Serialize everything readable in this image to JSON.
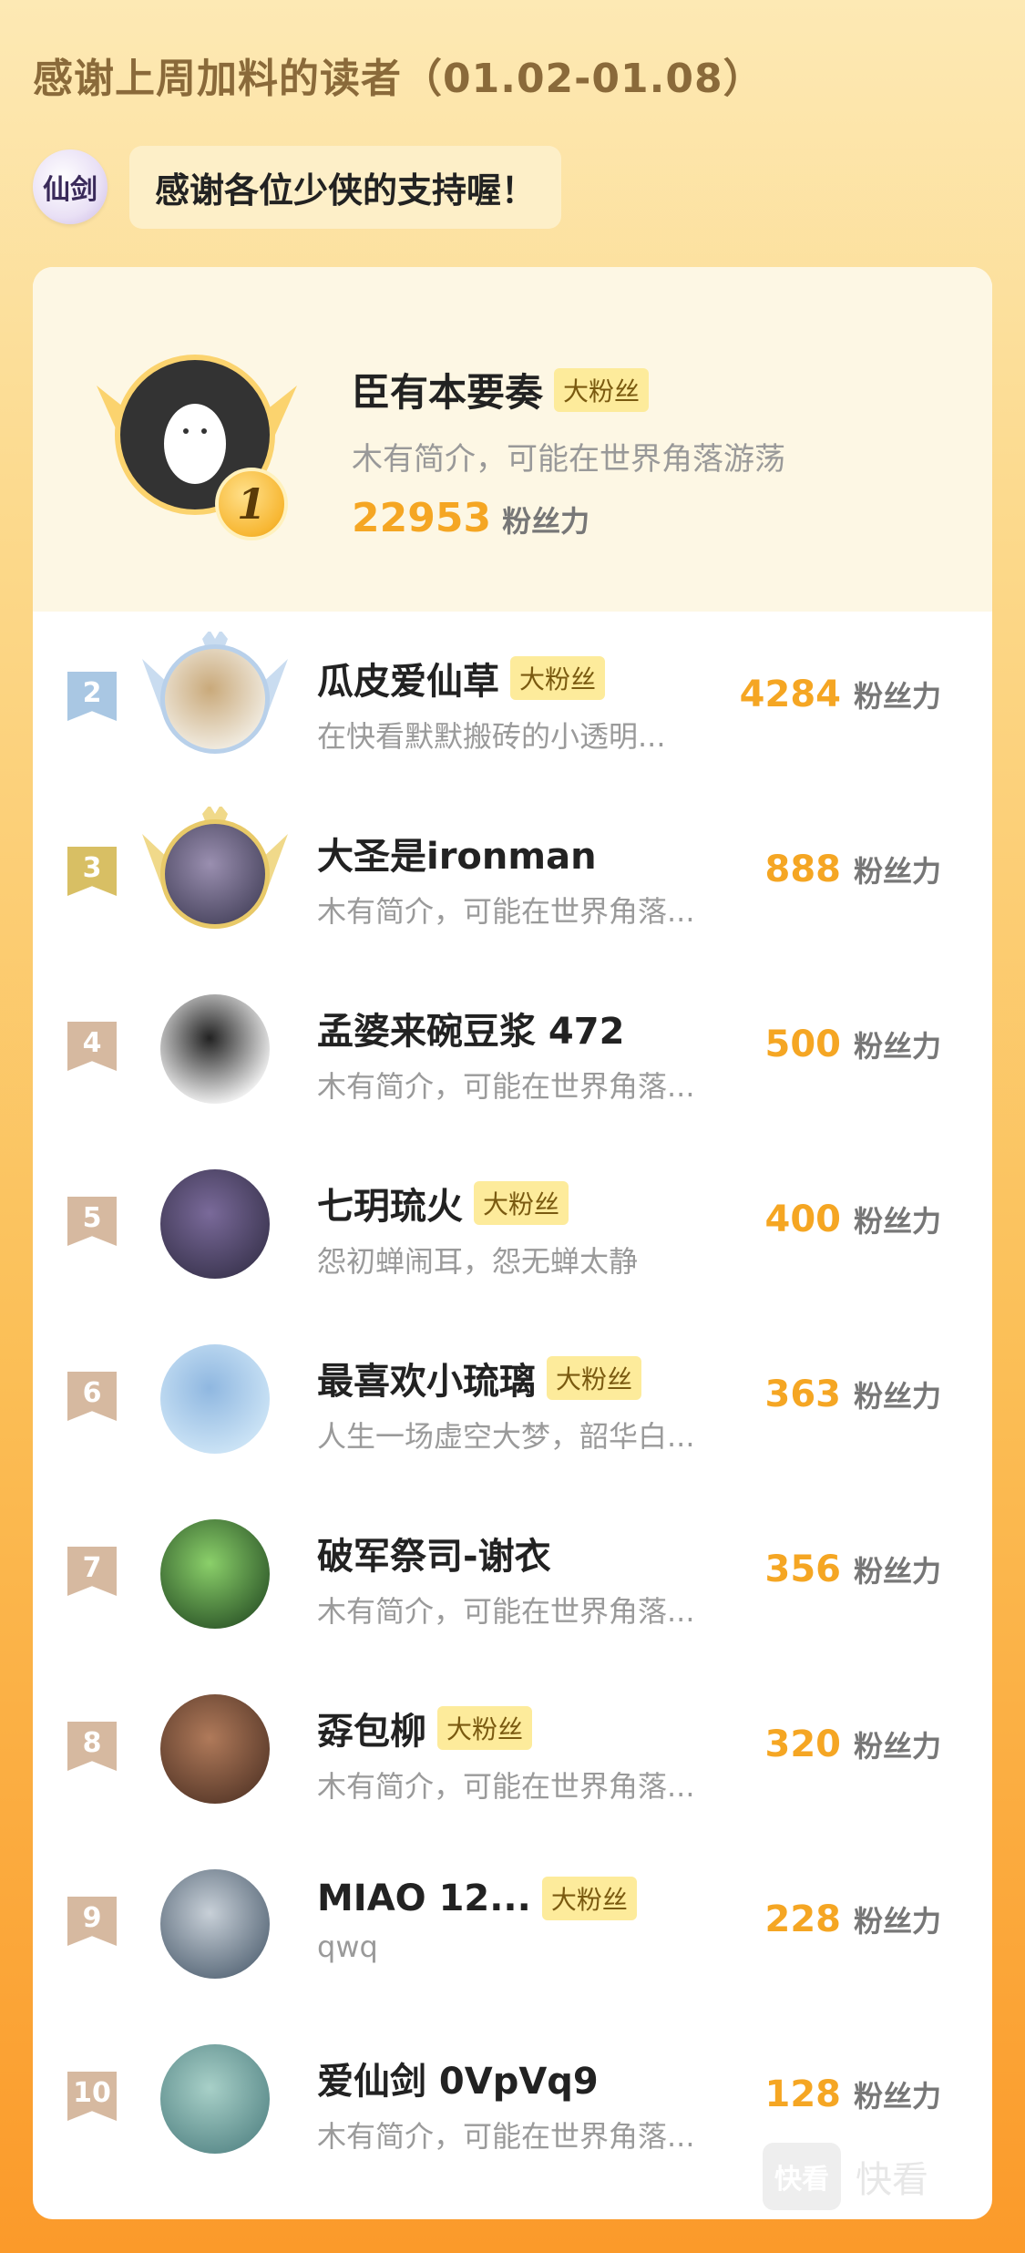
{
  "header": {
    "title": "感谢上周加料的读者（01.02-01.08）"
  },
  "brand": {
    "logo_text": "仙剑",
    "bubble_text": "感谢各位少侠的支持喔！"
  },
  "champion": {
    "rank": "1",
    "name": "臣有本要奏",
    "tag": "大粉丝",
    "desc": "木有简介，可能在世界角落游荡",
    "score": "22953",
    "score_unit": "粉丝力"
  },
  "ranks": [
    {
      "rank": "2",
      "name": "瓜皮爱仙草",
      "tag": "大粉丝",
      "desc": "在快看默默搬砖的小透明...",
      "score": "4284",
      "unit": "粉丝力"
    },
    {
      "rank": "3",
      "name": "大圣是ironman",
      "tag": "",
      "desc": "木有简介，可能在世界角落...",
      "score": "888",
      "unit": "粉丝力"
    },
    {
      "rank": "4",
      "name": "孟婆来碗豆浆 472",
      "tag": "",
      "desc": "木有简介，可能在世界角落...",
      "score": "500",
      "unit": "粉丝力"
    },
    {
      "rank": "5",
      "name": "七玥琉火",
      "tag": "大粉丝",
      "desc": "怨初蝉闹耳，怨无蝉太静",
      "score": "400",
      "unit": "粉丝力"
    },
    {
      "rank": "6",
      "name": "最喜欢小琉璃",
      "tag": "大粉丝",
      "desc": "人生一场虚空大梦，韶华白...",
      "score": "363",
      "unit": "粉丝力"
    },
    {
      "rank": "7",
      "name": "破军祭司-谢衣",
      "tag": "",
      "desc": "木有简介，可能在世界角落...",
      "score": "356",
      "unit": "粉丝力"
    },
    {
      "rank": "8",
      "name": "孬包柳",
      "tag": "大粉丝",
      "desc": "木有简介，可能在世界角落...",
      "score": "320",
      "unit": "粉丝力"
    },
    {
      "rank": "9",
      "name": "MIAO 12...",
      "tag": "大粉丝",
      "desc": "qwq",
      "score": "228",
      "unit": "粉丝力"
    },
    {
      "rank": "10",
      "name": "爱仙剑 0VpVq9",
      "tag": "",
      "desc": "木有简介，可能在世界角落...",
      "score": "128",
      "unit": "粉丝力"
    }
  ],
  "watermark": {
    "box": "快看",
    "text": "快看"
  },
  "colors": {
    "accent": "#f5a623",
    "tag_bg": "#fdeb9b",
    "silver": "#a9c7e3",
    "gold": "#d8bf64"
  }
}
